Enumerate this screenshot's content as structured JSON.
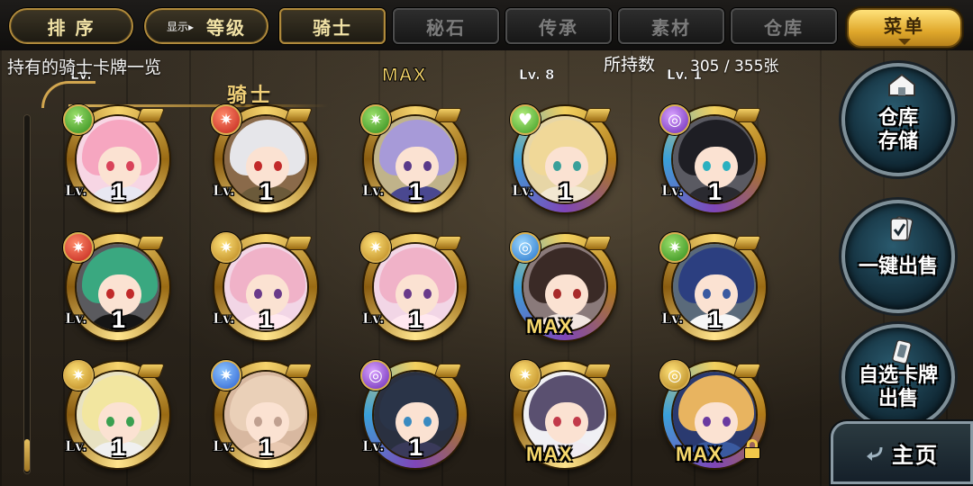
{
  "header": {
    "sort_label": "排 序",
    "display_prefix": "显示",
    "display_value": "等级",
    "menu_label": "菜单",
    "tabs": [
      {
        "label": "骑士",
        "active": true
      },
      {
        "label": "秘石",
        "active": false
      },
      {
        "label": "传承",
        "active": false
      },
      {
        "label": "素材",
        "active": false
      },
      {
        "label": "仓库",
        "active": false
      }
    ]
  },
  "info": {
    "list_title": "持有的骑士卡牌一览",
    "count_label": "所持数",
    "count_value": "305 / 355张",
    "section_label": "骑士"
  },
  "peek_row": {
    "items": [
      "Lv.",
      "MAX",
      "Lv. 8",
      "Lv. 1"
    ]
  },
  "cards": [
    {
      "attr": "star-green",
      "attr_icon": "star-icon",
      "level_label": "Lv.",
      "level": "1",
      "max": false,
      "hair": "#f6a6c0",
      "outfit": "#e8e8f2",
      "eyes": "#d9435a",
      "bg": "#f7d6e4",
      "locked": false
    },
    {
      "attr": "star-red",
      "attr_icon": "star-icon",
      "level_label": "Lv.",
      "level": "1",
      "max": false,
      "hair": "#e6e6ea",
      "outfit": "#6b5a3a",
      "eyes": "#c22a2a",
      "bg": "#8a6a4a",
      "locked": false
    },
    {
      "attr": "star-green",
      "attr_icon": "star-icon",
      "level_label": "Lv.",
      "level": "1",
      "max": false,
      "hair": "#a79ad8",
      "outfit": "#4a4890",
      "eyes": "#5a3a8a",
      "bg": "#c0b38a",
      "locked": false
    },
    {
      "attr": "heart-green",
      "attr_icon": "heart-icon",
      "level_label": "Lv.",
      "level": "1",
      "max": false,
      "hair": "#f0d898",
      "outfit": "#f2e8d2",
      "eyes": "#3aa09a",
      "bg": "#e7d6a6",
      "locked": false
    },
    {
      "attr": "swirl-purple",
      "attr_icon": "swirl-icon",
      "level_label": "Lv.",
      "level": "1",
      "max": false,
      "hair": "#1e1e24",
      "outfit": "#2a2a30",
      "eyes": "#2bb0c0",
      "bg": "#5a5a62",
      "locked": false
    },
    {
      "attr": "star-red",
      "attr_icon": "star-icon",
      "level_label": "Lv.",
      "level": "1",
      "max": false,
      "hair": "#3aa880",
      "outfit": "#151515",
      "eyes": "#c12a2a",
      "bg": "#5a5a5e",
      "locked": false
    },
    {
      "attr": "star-gold",
      "attr_icon": "star-icon",
      "level_label": "Lv.",
      "level": "1",
      "max": false,
      "hair": "#f0b2c8",
      "outfit": "#ffe8f0",
      "eyes": "#6a3a8a",
      "bg": "#f2d6e6",
      "locked": false
    },
    {
      "attr": "star-gold",
      "attr_icon": "star-icon",
      "level_label": "Lv.",
      "level": "1",
      "max": false,
      "hair": "#f0b2c8",
      "outfit": "#ffe8f0",
      "eyes": "#6a3a8a",
      "bg": "#f2d6e6",
      "locked": false
    },
    {
      "attr": "swirl-blue",
      "attr_icon": "swirl-icon",
      "level_label": "",
      "level": "",
      "max": true,
      "max_label": "MAX",
      "hair": "#3a2a26",
      "outfit": "#f2e6e0",
      "eyes": "#a82a2a",
      "bg": "#8a7a7a",
      "locked": false
    },
    {
      "attr": "star-green",
      "attr_icon": "star-icon",
      "level_label": "Lv.",
      "level": "1",
      "max": false,
      "hair": "#2c3f80",
      "outfit": "#f6f6f6",
      "eyes": "#3a5aa0",
      "bg": "#5a6a7a",
      "locked": false
    },
    {
      "attr": "star-gold",
      "attr_icon": "star-icon",
      "level_label": "Lv.",
      "level": "1",
      "max": false,
      "hair": "#f2e6a0",
      "outfit": "#f0f0f0",
      "eyes": "#3aa050",
      "bg": "#e8e2c2",
      "locked": false
    },
    {
      "attr": "star-blue",
      "attr_icon": "star-icon",
      "level_label": "Lv.",
      "level": "1",
      "max": false,
      "hair": "#ead0b8",
      "outfit": "#e8c8b0",
      "eyes": "#c0a090",
      "bg": "#d8b8a0",
      "locked": false
    },
    {
      "attr": "swirl-purple",
      "attr_icon": "swirl-icon",
      "level_label": "Lv.",
      "level": "1",
      "max": false,
      "hair": "#2a3448",
      "outfit": "#3a3a5a",
      "eyes": "#3a8ac0",
      "bg": "#2a3040",
      "locked": false
    },
    {
      "attr": "star-gold",
      "attr_icon": "star-icon",
      "level_label": "",
      "level": "",
      "max": true,
      "max_label": "MAX",
      "hair": "#5a5070",
      "outfit": "#f0ecf2",
      "eyes": "#c23a4a",
      "bg": "#f0f0f4",
      "locked": false
    },
    {
      "attr": "swirl-gold",
      "attr_icon": "swirl-icon",
      "level_label": "",
      "level": "",
      "max": true,
      "max_label": "MAX",
      "hair": "#e8b460",
      "outfit": "#3a5aa0",
      "eyes": "#6a3aa0",
      "bg": "#2a3a70",
      "locked": true
    }
  ],
  "side": {
    "warehouse_label_1": "仓库",
    "warehouse_label_2": "存储",
    "sell_label": "一键出售",
    "select_label_1": "自选卡牌",
    "select_label_2": "出售",
    "home_label": "主页"
  }
}
